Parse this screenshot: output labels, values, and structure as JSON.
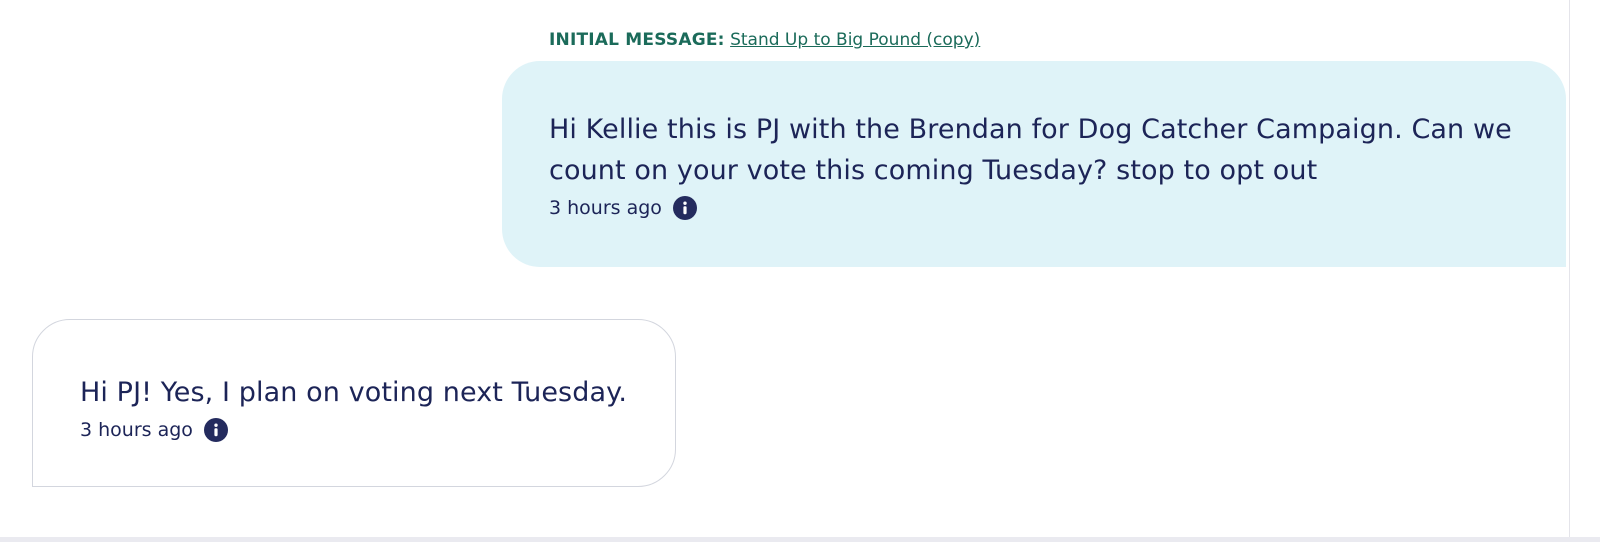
{
  "initial_message": {
    "prefix": "INITIAL MESSAGE:",
    "link_text": "Stand Up to Big Pound (copy)"
  },
  "messages": [
    {
      "direction": "outgoing",
      "text": "Hi Kellie this is PJ with the Brendan for Dog Catcher Campaign. Can we count on your vote this coming Tuesday? stop to opt out",
      "timestamp": "3 hours ago",
      "icon": "info-icon"
    },
    {
      "direction": "incoming",
      "text": "Hi PJ! Yes, I plan on voting next Tuesday.",
      "timestamp": "3 hours ago",
      "icon": "info-icon"
    }
  ],
  "colors": {
    "outgoing_bubble": "#dff3f8",
    "incoming_border": "#d3d6de",
    "text": "#1c2457",
    "label": "#1b6b5a",
    "icon": "#242b5e"
  }
}
